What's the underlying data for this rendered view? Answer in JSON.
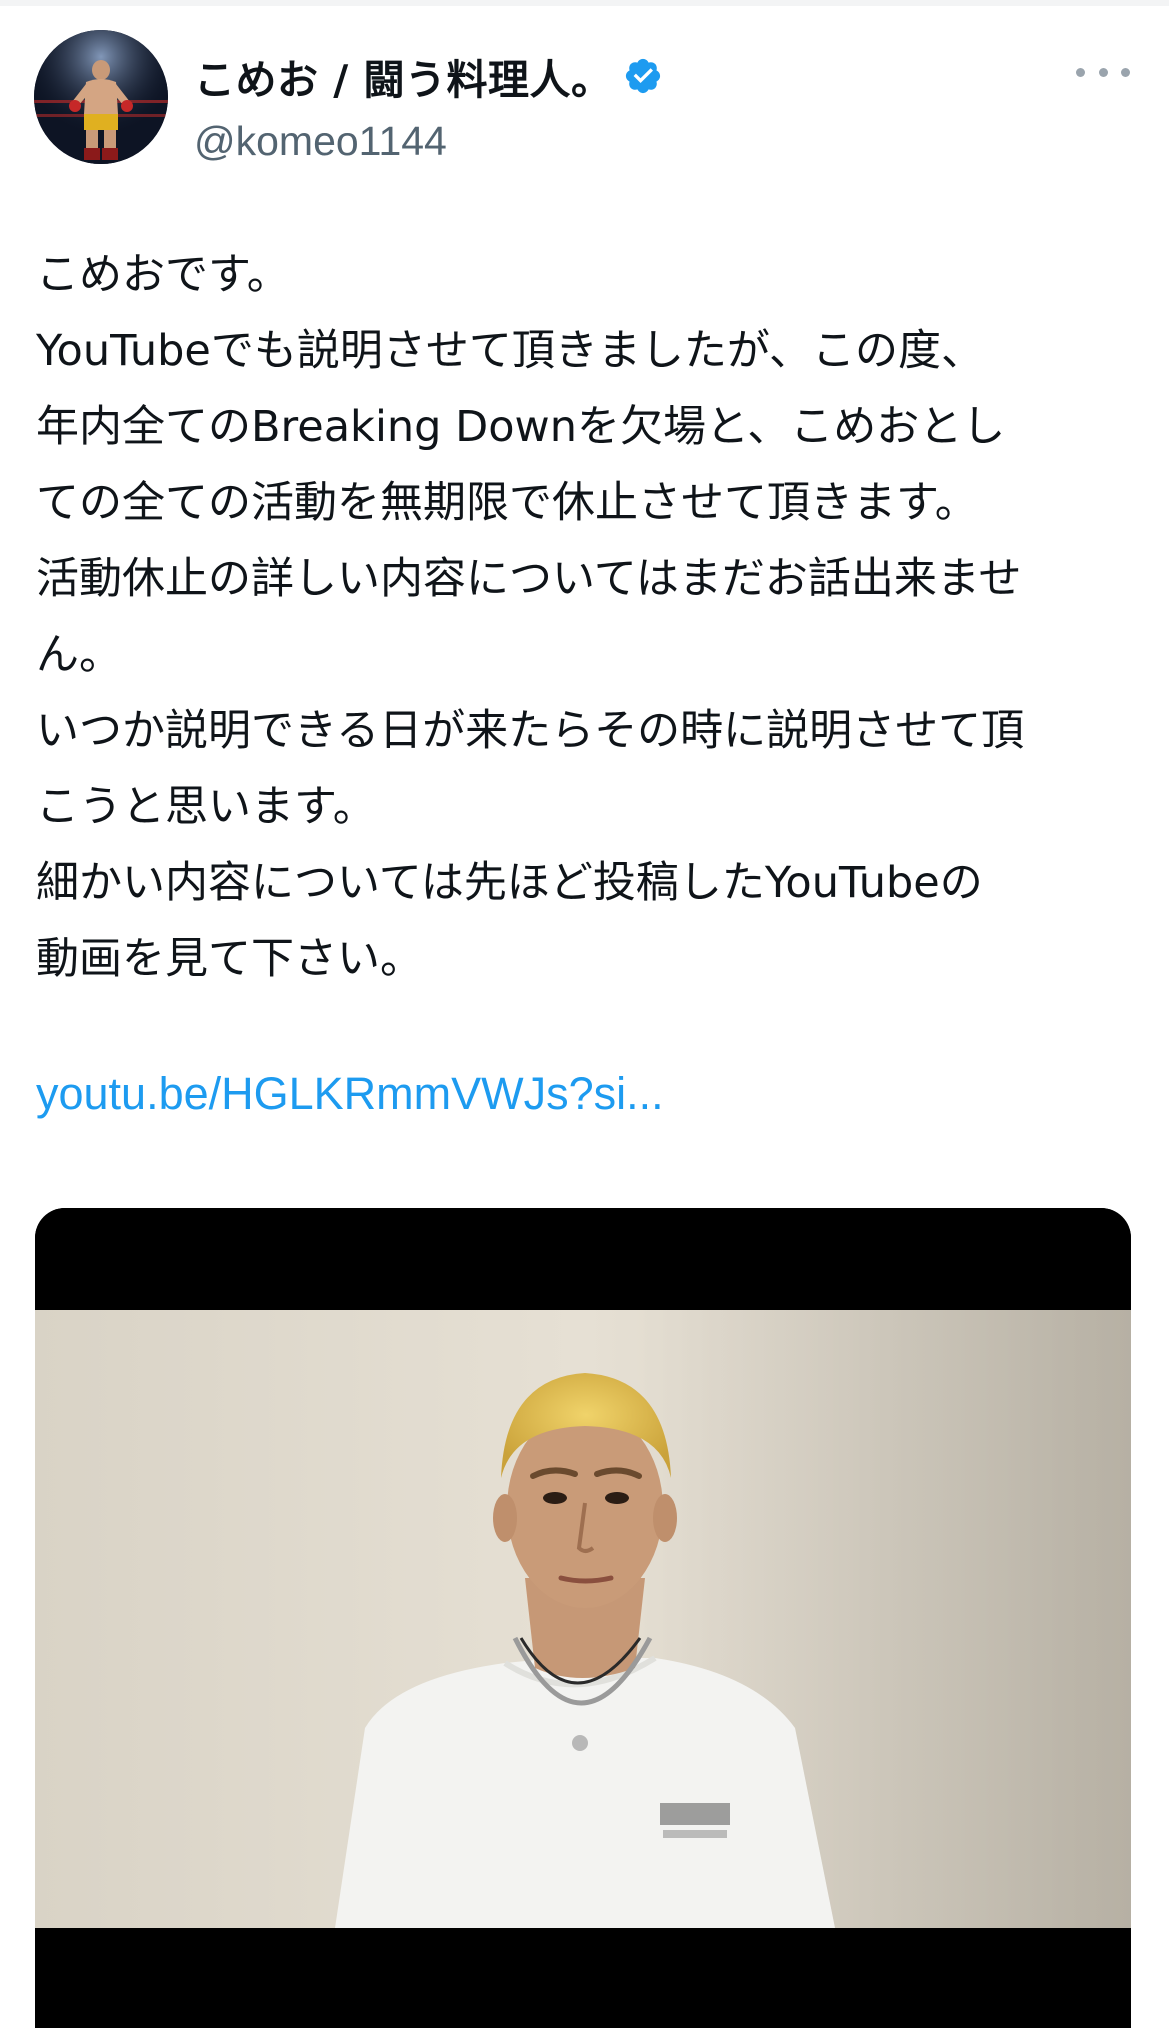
{
  "author": {
    "display_name": "こめお / 闘う料理人。",
    "handle": "@komeo1144",
    "verified": true
  },
  "tweet": {
    "lines": [
      "こめおです。",
      "YouTubeでも説明させて頂きましたが、この度、",
      "年内全てのBreaking Downを欠場と、こめおとし",
      "ての全ての活動を無期限で休止させて頂きます。",
      "活動休止の詳しい内容についてはまだお話出来ませ",
      "ん。",
      "いつか説明できる日が来たらその時に説明させて頂",
      "こうと思います。",
      "細かい内容については先ほど投稿したYouTubeの",
      "動画を見て下さい。"
    ],
    "link_text": "youtu.be/HGLKRmmVWJs?si..."
  },
  "icons": {
    "verified": "verified-badge-icon",
    "more": "more-options-icon"
  },
  "colors": {
    "link": "#1d9bf0",
    "verified": "#1d9bf0",
    "secondary_text": "#536471",
    "primary_text": "#0f1419"
  }
}
